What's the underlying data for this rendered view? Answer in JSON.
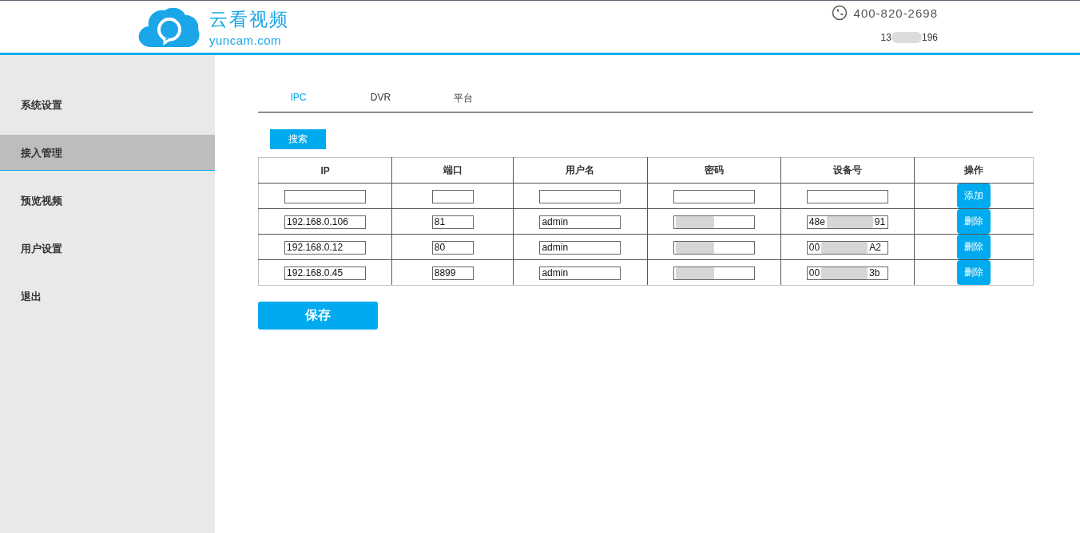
{
  "header": {
    "brand": "云看视频",
    "domain": "yuncam.com",
    "phone": "400-820-2698",
    "account_start": "13",
    "account_end": "196"
  },
  "sidebar": {
    "items": [
      {
        "label": "系统设置",
        "selected": false
      },
      {
        "label": "接入管理",
        "selected": true
      },
      {
        "label": "预览视频",
        "selected": false
      },
      {
        "label": "用户设置",
        "selected": false
      },
      {
        "label": "退出",
        "selected": false
      }
    ]
  },
  "tabs": [
    {
      "label": "IPC",
      "selected": true
    },
    {
      "label": "DVR",
      "selected": false
    },
    {
      "label": "平台",
      "selected": false
    }
  ],
  "search_button": "搜索",
  "table": {
    "columns": [
      "IP",
      "端口",
      "用户名",
      "密码",
      "设备号",
      "操作"
    ],
    "rows": [
      {
        "ip": "",
        "port": "",
        "user": "",
        "password_redacted": false,
        "device_start": "",
        "device_end": "",
        "device_redacted": false,
        "action": "添加"
      },
      {
        "ip": "192.168.0.106",
        "port": "81",
        "user": "admin",
        "password_redacted": true,
        "device_start": "48e",
        "device_end": "91",
        "device_redacted": true,
        "action": "删除"
      },
      {
        "ip": "192.168.0.12",
        "port": "80",
        "user": "admin",
        "password_redacted": true,
        "device_start": "00",
        "device_end": "A2",
        "device_redacted": true,
        "action": "删除"
      },
      {
        "ip": "192.168.0.45",
        "port": "8899",
        "user": "admin",
        "password_redacted": true,
        "device_start": "00",
        "device_end": "3b",
        "device_redacted": true,
        "action": "删除"
      }
    ]
  },
  "save_button": "保存"
}
